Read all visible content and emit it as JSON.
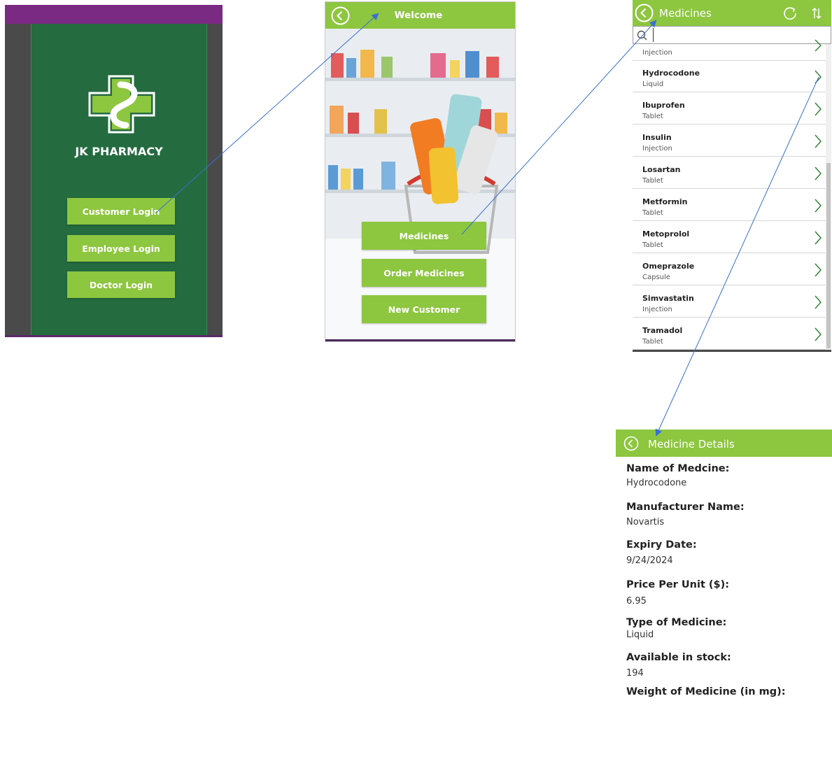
{
  "colors": {
    "accent": "#8dc63f",
    "dark_green": "#246b3f",
    "purple": "#7a2a82"
  },
  "screen1": {
    "logo_text": "JK PHARMACY",
    "buttons": [
      "Customer Login",
      "Employee Login",
      "Doctor Login"
    ]
  },
  "screen2": {
    "title": "Welcome",
    "buttons": [
      "Medicines",
      "Order Medicines",
      "New Customer"
    ]
  },
  "screen3": {
    "title": "Medicines",
    "search_placeholder": "",
    "partial_row_type": "Injection",
    "items": [
      {
        "name": "Hydrocodone",
        "type": "Liquid"
      },
      {
        "name": "Ibuprofen",
        "type": "Tablet"
      },
      {
        "name": "Insulin",
        "type": "Injection"
      },
      {
        "name": "Losartan",
        "type": "Tablet"
      },
      {
        "name": "Metformin",
        "type": "Tablet"
      },
      {
        "name": "Metoprolol",
        "type": "Tablet"
      },
      {
        "name": "Omeprazole",
        "type": "Capsule"
      },
      {
        "name": "Simvastatin",
        "type": "Injection"
      },
      {
        "name": "Tramadol",
        "type": "Tablet"
      }
    ]
  },
  "screen4": {
    "title": "Medicine Details",
    "fields": [
      {
        "label": "Name of Medcine:",
        "value": "Hydrocodone"
      },
      {
        "label": "Manufacturer Name:",
        "value": "Novartis"
      },
      {
        "label": "Expiry Date:",
        "value": "9/24/2024"
      },
      {
        "label": "Price Per Unit ($):",
        "value": "6.95"
      },
      {
        "label": "Type of Medicine:",
        "value": "Liquid"
      },
      {
        "label": "Available in stock:",
        "value": "194"
      },
      {
        "label": "Weight of Medicine (in mg):",
        "value": ""
      }
    ]
  }
}
